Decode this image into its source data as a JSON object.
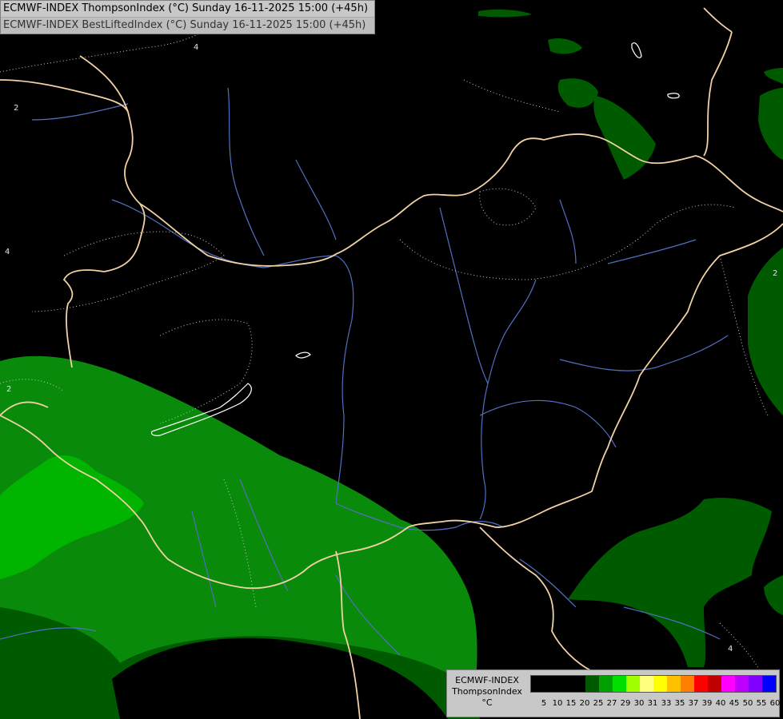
{
  "header": {
    "line1": "ECMWF-INDEX ThompsonIndex (°C) Sunday 16-11-2025 15:00 (+45h)",
    "line2": "ECMWF-INDEX BestLiftedIndex (°C) Sunday 16-11-2025 15:00 (+45h)"
  },
  "legend": {
    "title_line1": "ECMWF-INDEX",
    "title_line2": "ThompsonIndex",
    "unit": "°C",
    "ticks": [
      "5",
      "10",
      "15",
      "20",
      "25",
      "27",
      "29",
      "30",
      "31",
      "33",
      "35",
      "37",
      "39",
      "40",
      "45",
      "50",
      "55",
      "60"
    ],
    "colors": [
      "#000000",
      "#000000",
      "#000000",
      "#000000",
      "#005a00",
      "#00a000",
      "#00e000",
      "#a0ff00",
      "#ffff80",
      "#ffff00",
      "#ffc000",
      "#ff8000",
      "#ff0000",
      "#c00000",
      "#ff00ff",
      "#c000ff",
      "#8000ff",
      "#0000ff"
    ]
  },
  "contour_labels": [
    "4",
    "4",
    "2",
    "2",
    "2",
    "4"
  ],
  "colors": {
    "background": "#000000",
    "zone_dark_green": "#005a00",
    "zone_medium_green": "#0a8a0a",
    "zone_bright_green": "#00b400",
    "border": "#f2d2a4",
    "river": "#5070c0",
    "contour": "#c8c8c8"
  }
}
